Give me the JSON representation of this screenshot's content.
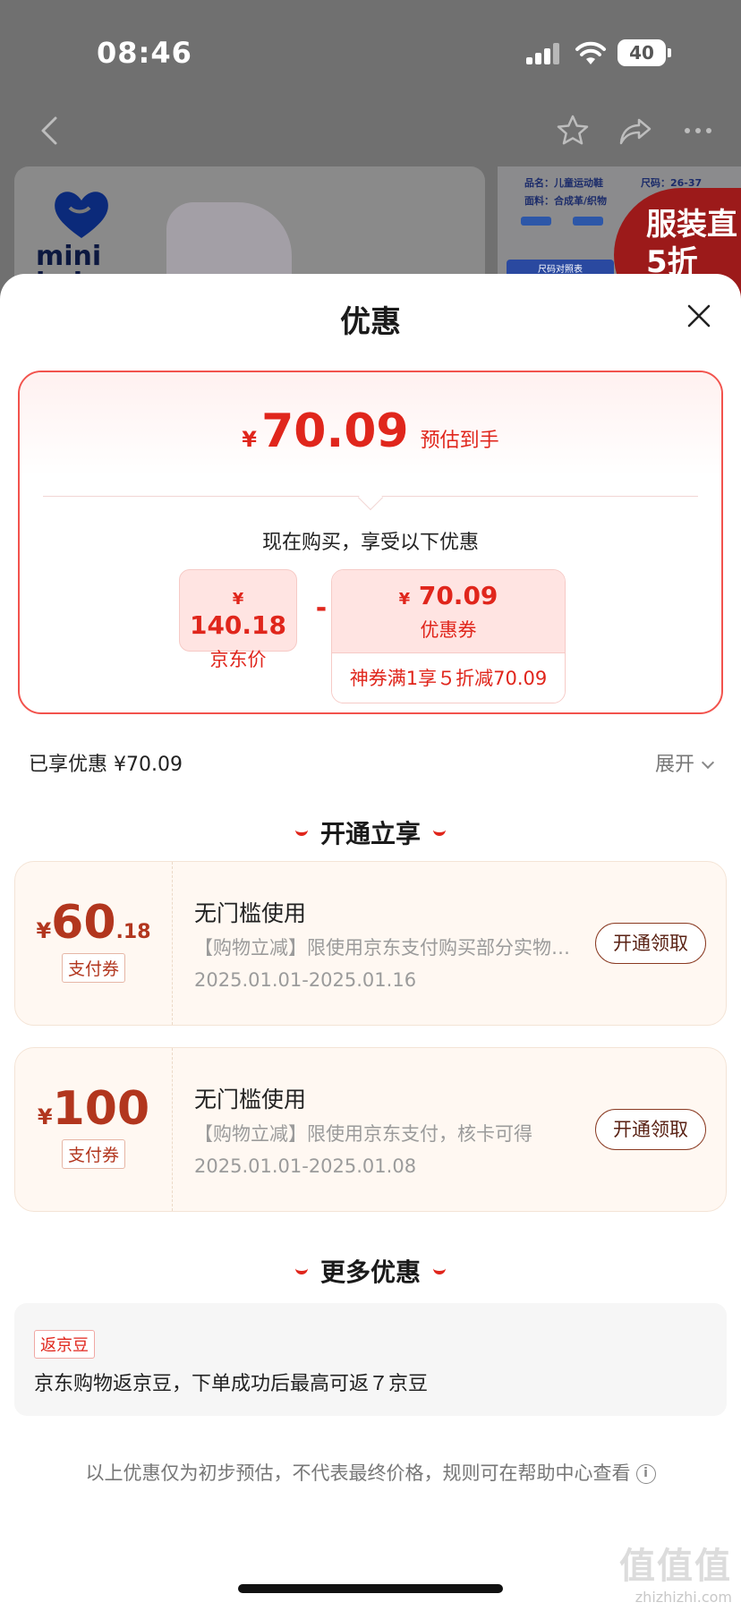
{
  "status_bar": {
    "time": "08:46",
    "battery": "40"
  },
  "background_product": {
    "logo_text_line1": "mini",
    "logo_text_line2": "bala",
    "side_name": "品名：儿童运动鞋",
    "side_size": "尺码：26-37",
    "side_material": "面料：合成革/织物",
    "side_bar": "尺码对照表",
    "promo": "服装直5折"
  },
  "sheet": {
    "title": "优惠",
    "summary": {
      "yen": "¥",
      "final_price": "70.09",
      "final_note": "预估到手",
      "enjoy_text": "现在购买，享受以下优惠",
      "jd_price": {
        "yen": "¥",
        "value": "140.18",
        "label": "京东价"
      },
      "minus": "-",
      "coupon": {
        "yen": "¥",
        "value": "70.09",
        "label": "优惠券",
        "desc": "神券满1享５折减70.09"
      }
    },
    "enjoyed": "已享优惠 ¥70.09",
    "expand": "展开",
    "section_open": "开通立享",
    "coupons": [
      {
        "yen": "¥",
        "amount": "60",
        "decimal": ".18",
        "tag": "支付券",
        "title": "无门槛使用",
        "rule": "【购物立减】限使用京东支付购买部分实物商品",
        "date": "2025.01.01-2025.01.16",
        "button": "开通领取"
      },
      {
        "yen": "¥",
        "amount": "100",
        "decimal": "",
        "tag": "支付券",
        "title": "无门槛使用",
        "rule": "【购物立减】限使用京东支付，核卡可得",
        "date": "2025.01.01-2025.01.08",
        "button": "开通领取"
      }
    ],
    "section_more": "更多优惠",
    "more": {
      "tag": "返京豆",
      "text": "京东购物返京豆，下单成功后最高可返７京豆"
    },
    "footnote": "以上优惠仅为初步预估，不代表最终价格，规则可在帮助中心查看",
    "info_icon_glyph": "i"
  },
  "watermark": {
    "cn": "值值值",
    "en": "zhizhizhi.com"
  }
}
